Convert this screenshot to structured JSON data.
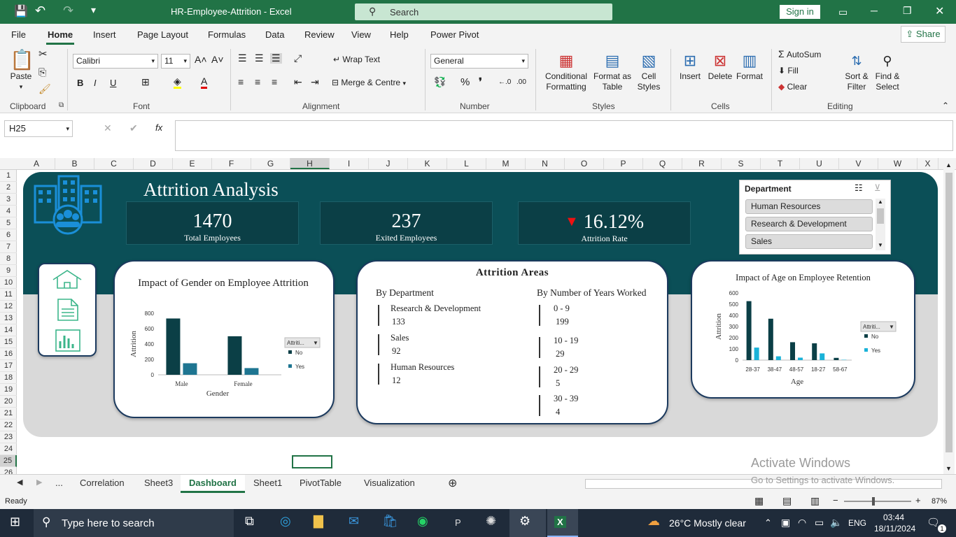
{
  "titlebar": {
    "doc_title": "HR-Employee-Attrition  -  Excel",
    "search_placeholder": "Search",
    "signin_label": "Sign in"
  },
  "menu": {
    "items": [
      "File",
      "Home",
      "Insert",
      "Page Layout",
      "Formulas",
      "Data",
      "Review",
      "View",
      "Help",
      "Power Pivot"
    ],
    "active": "Home",
    "share_label": "Share"
  },
  "ribbon": {
    "clipboard": {
      "paste": "Paste",
      "group": "Clipboard"
    },
    "font": {
      "name": "Calibri",
      "size": "11",
      "group": "Font",
      "bold": "B",
      "italic": "I",
      "underline": "U"
    },
    "alignment": {
      "wrap": "Wrap Text",
      "merge": "Merge & Centre",
      "group": "Alignment"
    },
    "number": {
      "format": "General",
      "group": "Number"
    },
    "styles": {
      "conditional": "Conditional\nFormatting",
      "format_table": "Format as\nTable",
      "cell_styles": "Cell\nStyles",
      "group": "Styles"
    },
    "cells": {
      "insert": "Insert",
      "delete": "Delete",
      "format": "Format",
      "group": "Cells"
    },
    "editing": {
      "autosum": "AutoSum",
      "fill": "Fill",
      "clear": "Clear",
      "sort": "Sort &\nFilter",
      "find": "Find &\nSelect",
      "group": "Editing"
    }
  },
  "formula_bar": {
    "name_box": "H25",
    "fx": "fx",
    "formula": ""
  },
  "columns": [
    "A",
    "B",
    "C",
    "D",
    "E",
    "F",
    "G",
    "H",
    "I",
    "J",
    "K",
    "L",
    "M",
    "N",
    "O",
    "P",
    "Q",
    "R",
    "S",
    "T",
    "U",
    "V",
    "W",
    "X"
  ],
  "rows": [
    "1",
    "2",
    "3",
    "4",
    "5",
    "6",
    "7",
    "8",
    "9",
    "10",
    "11",
    "12",
    "13",
    "14",
    "15",
    "16",
    "17",
    "18",
    "19",
    "20",
    "21",
    "22",
    "23",
    "24",
    "25",
    "26"
  ],
  "dashboard": {
    "title": "Attrition Analysis",
    "kpis": [
      {
        "value": "1470",
        "label": "Total Employees"
      },
      {
        "value": "237",
        "label": "Exited Employees"
      },
      {
        "value": "16.12%",
        "label": "Attrition Rate"
      }
    ],
    "slicer": {
      "title": "Department",
      "items": [
        "Human Resources",
        "Research & Development",
        "Sales"
      ]
    },
    "attrition_areas": {
      "title": "Attrition Areas",
      "by_dept_title": "By Department",
      "by_years_title": "By Number of Years Worked",
      "departments": [
        {
          "name": "Research & Development",
          "value": "133"
        },
        {
          "name": "Sales",
          "value": "92"
        },
        {
          "name": "Human Resources",
          "value": "12"
        }
      ],
      "years": [
        {
          "range": "0 - 9",
          "value": "199"
        },
        {
          "range": "10 -  19",
          "value": "29"
        },
        {
          "range": "20 - 29",
          "value": "5"
        },
        {
          "range": "30 - 39",
          "value": "4"
        }
      ]
    },
    "colors": {
      "no": "#0b3f46",
      "yes": "#1e7591",
      "yes_age": "#1ab2d8",
      "banner": "#0b4f57"
    }
  },
  "chart_data": [
    {
      "type": "bar",
      "title": "Impact of Gender on Employee Attrition",
      "xlabel": "Gender",
      "ylabel": "Attrition",
      "categories": [
        "Male",
        "Female"
      ],
      "series": [
        {
          "name": "No",
          "values": [
            732,
            501
          ]
        },
        {
          "name": "Yes",
          "values": [
            150,
            87
          ]
        }
      ],
      "ylim": [
        0,
        800
      ],
      "yticks": [
        "0",
        "200",
        "400",
        "600",
        "800"
      ],
      "legend_title": "Attriti...",
      "legend": "right"
    },
    {
      "type": "bar",
      "title": "Impact of Age on Employee Retention",
      "xlabel": "Age",
      "ylabel": "Attrition",
      "categories": [
        "28-37",
        "38-47",
        "48-57",
        "18-27",
        "58-67"
      ],
      "series": [
        {
          "name": "No",
          "values": [
            527,
            370,
            160,
            150,
            20
          ]
        },
        {
          "name": "Yes",
          "values": [
            112,
            34,
            22,
            60,
            3
          ]
        }
      ],
      "ylim": [
        0,
        600
      ],
      "yticks": [
        "0",
        "100",
        "200",
        "300",
        "400",
        "500",
        "600"
      ],
      "legend_title": "Attriti...",
      "legend": "right"
    }
  ],
  "sheet_tabs": {
    "ellipsis": "...",
    "tabs": [
      "Correlation",
      "Sheet3",
      "Dashboard",
      "Sheet1",
      "PivotTable",
      "Visualization"
    ],
    "active": "Dashboard"
  },
  "statusbar": {
    "ready": "Ready",
    "zoom": "87%"
  },
  "watermark": {
    "line1": "Activate Windows",
    "line2": "Go to Settings to activate Windows."
  },
  "taskbar": {
    "search_placeholder": "Type here to search",
    "weather": "26°C  Mostly clear",
    "lang": "ENG",
    "time": "03:44",
    "date": "18/11/2024",
    "notifications": "1"
  }
}
